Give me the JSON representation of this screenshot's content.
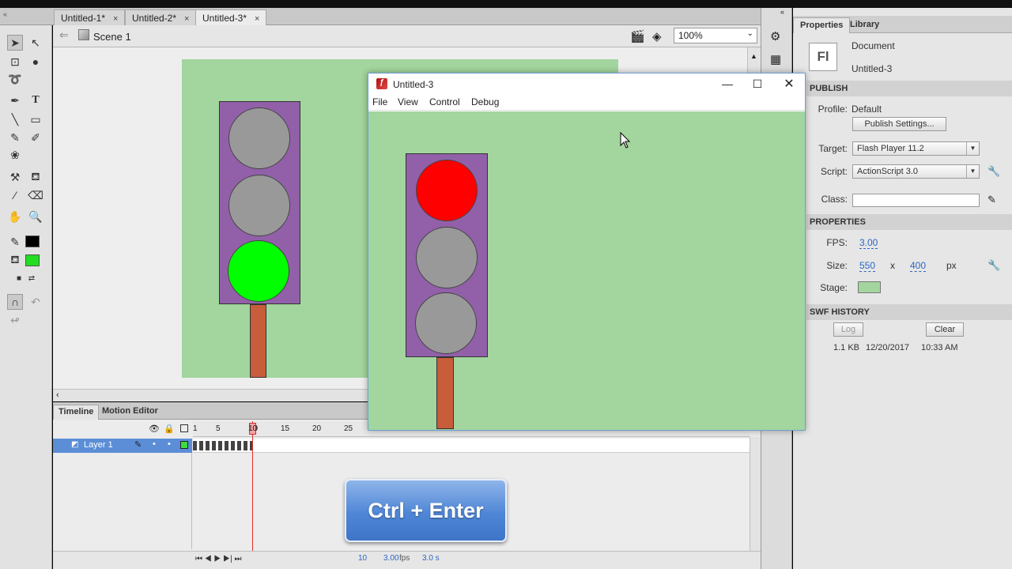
{
  "tabs": [
    {
      "label": "Untitled-1*",
      "close": "×"
    },
    {
      "label": "Untitled-2*",
      "close": "×"
    },
    {
      "label": "Untitled-3*",
      "close": "×"
    }
  ],
  "editbar": {
    "scene": "Scene 1",
    "zoom": "100%"
  },
  "timeline": {
    "tabs": [
      "Timeline",
      "Motion Editor"
    ],
    "ruler": [
      "1",
      "5",
      "10",
      "15",
      "20",
      "25"
    ],
    "layer": "Layer 1",
    "current_frame": "10",
    "fps": "3.00",
    "fps_unit": "fps",
    "time": "3.0 s"
  },
  "player": {
    "title": "Untitled-3",
    "menu": [
      "File",
      "View",
      "Control",
      "Debug"
    ]
  },
  "overlay": {
    "text": "Ctrl + Enter"
  },
  "properties": {
    "tabs": [
      "Properties",
      "Library"
    ],
    "doc_icon": "Fl",
    "doc_type": "Document",
    "doc_name": "Untitled-3",
    "publish_header": "PUBLISH",
    "profile_label": "Profile:",
    "profile_value": "Default",
    "publish_settings_button": "Publish Settings...",
    "target_label": "Target:",
    "target_value": "Flash Player 11.2",
    "script_label": "Script:",
    "script_value": "ActionScript 3.0",
    "class_label": "Class:",
    "properties_header": "PROPERTIES",
    "fps_label": "FPS:",
    "fps_value": "3.00",
    "size_label": "Size:",
    "width": "550",
    "x": "x",
    "height": "400",
    "unit": "px",
    "stage_label": "Stage:",
    "stage_color": "#a3d59e",
    "swf_history_header": "SWF HISTORY",
    "log_button": "Log",
    "clear_button": "Clear",
    "history_size": "1.1 KB",
    "history_date": "12/20/2017",
    "history_time": "10:33 AM"
  },
  "colors": {
    "stage": "#a3d59e",
    "light_box": "#9160a8",
    "lamp_off": "#999999",
    "lamp_green": "#00ff00",
    "lamp_red": "#ff0000",
    "pole": "#c75d3a",
    "stroke_color": "#000000",
    "fill_color": "#22dd22"
  }
}
